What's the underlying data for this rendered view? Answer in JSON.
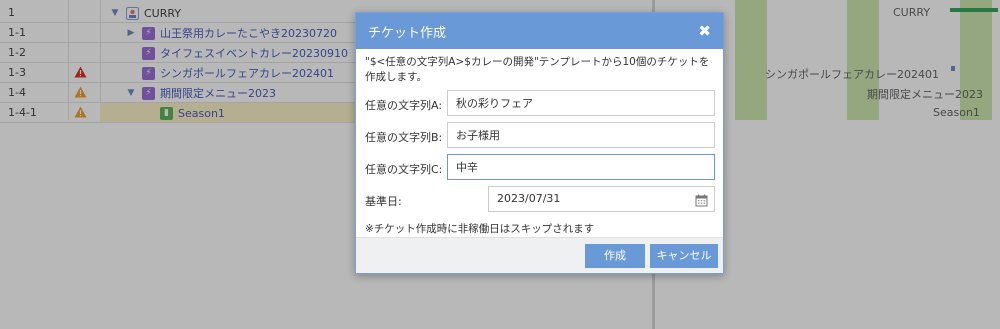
{
  "tree": {
    "rows": [
      {
        "id": "1",
        "label": "CURRY",
        "warn": "",
        "icon": "proj",
        "arrow": "▼",
        "indent": 0
      },
      {
        "id": "1-1",
        "label": "山王祭用カレーたこやき20230720",
        "warn": "",
        "icon": "epic",
        "arrow": "▶",
        "indent": 1
      },
      {
        "id": "1-2",
        "label": "タイフェスイベントカレー20230910",
        "warn": "",
        "icon": "epic",
        "arrow": "",
        "indent": 1
      },
      {
        "id": "1-3",
        "label": "シンガポールフェアカレー202401",
        "warn": "red",
        "icon": "epic",
        "arrow": "",
        "indent": 1
      },
      {
        "id": "1-4",
        "label": "期間限定メニュー2023",
        "warn": "orange",
        "icon": "epic",
        "arrow": "▼",
        "indent": 1
      },
      {
        "id": "1-4-1",
        "label": "Season1",
        "warn": "orange",
        "icon": "story",
        "arrow": "",
        "indent": 2
      }
    ]
  },
  "gantt": {
    "labels": [
      {
        "text": "CURRY"
      },
      {
        "text": "シンガポールフェアカレー202401"
      },
      {
        "text": "期間限定メニュー2023"
      },
      {
        "text": "Season1"
      }
    ]
  },
  "dialog": {
    "title": "チケット作成",
    "close_icon": "✖",
    "description": "\"$<任意の文字列A>$カレーの開発\"テンプレートから10個のチケットを作成します。",
    "fields": [
      {
        "label": "任意の文字列A:",
        "value": "秋の彩りフェア"
      },
      {
        "label": "任意の文字列B:",
        "value": "お子様用"
      },
      {
        "label": "任意の文字列C:",
        "value": "中辛"
      }
    ],
    "date_label": "基準日:",
    "date_value": "2023/07/31",
    "note": "※チケット作成時に非稼働日はスキップされます",
    "create_label": "作成",
    "cancel_label": "キャンセル"
  },
  "colors": {
    "accent": "#6a99d8",
    "warn_red": "#d9352c",
    "warn_orange": "#f0a030",
    "gantt_bar": "#c8e6a6",
    "selected_row": "#fbf1c8"
  }
}
